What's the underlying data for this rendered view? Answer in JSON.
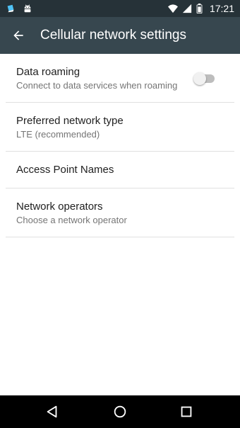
{
  "status_bar": {
    "time": "17:21",
    "left_icons": [
      "download-icon",
      "android-icon"
    ],
    "right_icons": [
      "wifi-icon",
      "cell-signal-icon",
      "battery-icon"
    ]
  },
  "app_bar": {
    "title": "Cellular network settings",
    "back_icon": "arrow-back-icon"
  },
  "settings": {
    "data_roaming": {
      "title": "Data roaming",
      "summary": "Connect to data services when roaming",
      "enabled": false
    },
    "preferred_network": {
      "title": "Preferred network type",
      "summary": "LTE (recommended)"
    },
    "apn": {
      "title": "Access Point Names"
    },
    "network_operators": {
      "title": "Network operators",
      "summary": "Choose a network operator"
    }
  },
  "nav_bar": {
    "icons": [
      "nav-back-icon",
      "nav-home-icon",
      "nav-recents-icon"
    ]
  },
  "colors": {
    "status_bar": "#263238",
    "app_bar": "#37474f",
    "divider": "#e0e0e0",
    "title_text": "#212121",
    "summary_text": "#757575"
  }
}
